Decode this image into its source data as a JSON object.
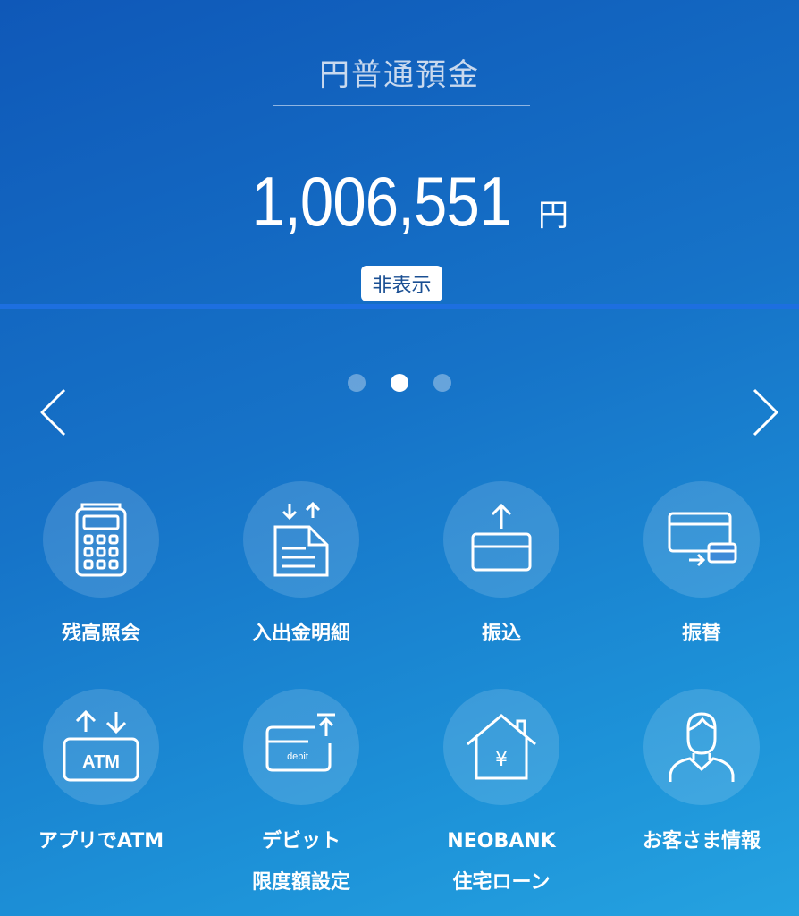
{
  "account": {
    "title": "円普通預金",
    "balance": "1,006,551",
    "unit": "円",
    "hide_label": "非表示"
  },
  "pager": {
    "total": 3,
    "active": 2
  },
  "menu": {
    "balance": {
      "label": "残高照会"
    },
    "statement": {
      "label": "入出金明細"
    },
    "transfer": {
      "label": "振込"
    },
    "account_transfer": {
      "label": "振替"
    },
    "app_atm": {
      "label": "アプリでATM",
      "icon_text": "ATM"
    },
    "debit_limit": {
      "line1": "デビット",
      "line2": "限度額設定",
      "icon_text": "debit"
    },
    "neobank_mortgage": {
      "line1": "NEOBANK",
      "line2": "住宅ローン",
      "icon_text": "¥"
    },
    "customer_info": {
      "label": "お客さま情報"
    }
  },
  "colors": {
    "accent": "#1d6fe0",
    "background_top": "#0f58b8",
    "background_bottom": "#25a2e0"
  }
}
